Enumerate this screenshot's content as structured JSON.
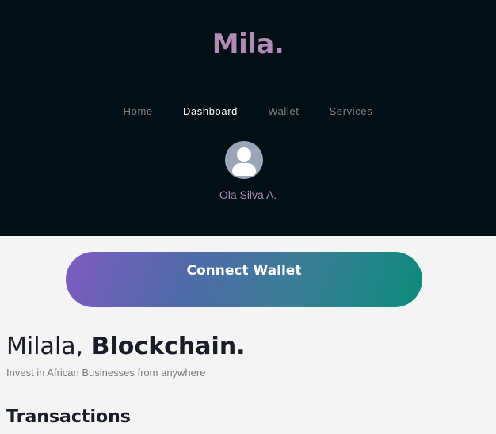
{
  "header": {
    "logo": "Mila.",
    "nav": [
      {
        "label": "Home",
        "active": false
      },
      {
        "label": "Dashboard",
        "active": true
      },
      {
        "label": "Wallet",
        "active": false
      },
      {
        "label": "Services",
        "active": false
      }
    ],
    "user": {
      "name": "Ola Silva A.",
      "avatar_icon": "user-avatar-icon"
    }
  },
  "actions": {
    "connect_wallet_label": "Connect Wallet"
  },
  "hero": {
    "title_light": "Milala,",
    "title_bold": "Blockchain.",
    "subtitle": "Invest in African Businesses from anywhere"
  },
  "sections": {
    "transactions_title": "Transactions"
  },
  "colors": {
    "header_bg": "#020f15",
    "accent_purple": "#b08bb3",
    "gradient_start": "#7e5cc2",
    "gradient_end": "#0a8c7a",
    "page_bg": "#f4f4f4"
  }
}
